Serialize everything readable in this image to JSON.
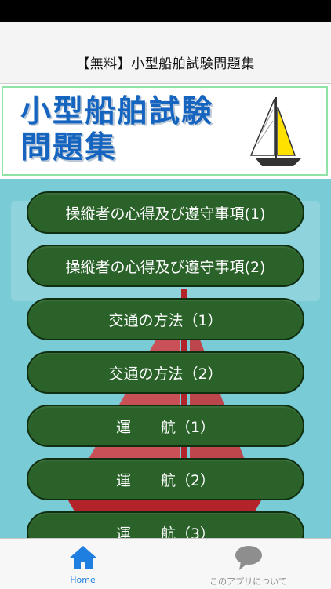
{
  "nav": {
    "title": "【無料】小型船舶試験問題集"
  },
  "banner": {
    "line1": "小型船舶試験",
    "line2": "問題集"
  },
  "menu": [
    {
      "label": "操縦者の心得及び遵守事項(1)"
    },
    {
      "label": "操縦者の心得及び遵守事項(2)"
    },
    {
      "label": "交通の方法（1）"
    },
    {
      "label": "交通の方法（2）"
    },
    {
      "label": "運　　航（1）"
    },
    {
      "label": "運　　航（2）"
    },
    {
      "label": "運　　航（3）"
    }
  ],
  "tabs": [
    {
      "label": "Home",
      "icon": "home-icon",
      "active": true
    },
    {
      "label": "このアプリについて",
      "icon": "speech-bubble-icon",
      "active": false
    }
  ],
  "colors": {
    "accent": "#1f7fe0",
    "button": "#2a6229",
    "content_bg": "#79cbd5",
    "banner_text": "#1565c0"
  }
}
